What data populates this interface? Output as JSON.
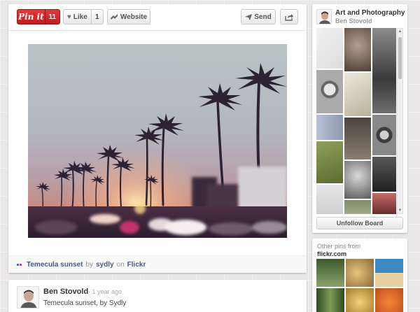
{
  "toolbar": {
    "pinit_label": "Pin it",
    "pinit_count": "11",
    "like_label": "Like",
    "like_count": "1",
    "website_label": "Website",
    "send_label": "Send",
    "icons": {
      "heart": "heart-icon",
      "website": "website-icon",
      "send": "send-icon",
      "share": "share-icon"
    }
  },
  "pin": {
    "caption_title": "Temecula sunset",
    "caption_by": "by",
    "caption_author": "sydly",
    "caption_on": "on",
    "caption_source": "Flickr"
  },
  "comment": {
    "name": "Ben Stovold",
    "time": "· 1 year ago",
    "text": "Temecula sunset, by Sydly"
  },
  "board": {
    "title": "Art and Photography",
    "owner": "Ben Stovold",
    "unfollow_label": "Unfollow Board"
  },
  "other_pins": {
    "heading": "Other pins from",
    "source": "flickr.com"
  },
  "colors": {
    "pinit_red": "#cb2027",
    "link_blue": "#4b5a7a",
    "page_bg": "#e9e7e7"
  }
}
